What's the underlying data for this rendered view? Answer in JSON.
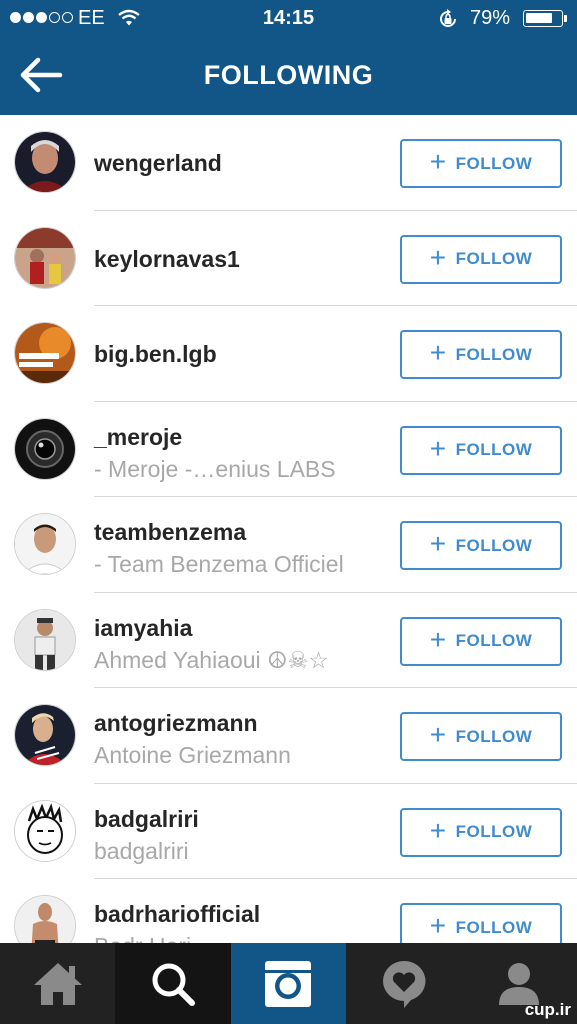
{
  "status_bar": {
    "carrier": "EE",
    "time": "14:15",
    "battery_percent": "79%",
    "battery_level": 0.79,
    "signal_bars_filled": 3,
    "signal_bars_total": 5
  },
  "nav": {
    "title": "FOLLOWING",
    "back_icon": "arrow-left-icon"
  },
  "follow_button": {
    "plus": "+",
    "label": "FOLLOW"
  },
  "users": [
    {
      "username": "wengerland",
      "full_name": ""
    },
    {
      "username": "keylornavas1",
      "full_name": ""
    },
    {
      "username": "big.ben.lgb",
      "full_name": ""
    },
    {
      "username": "_meroje",
      "full_name": "- Meroje -…enius LABS"
    },
    {
      "username": "teambenzema",
      "full_name": "- Team Benzema Officiel"
    },
    {
      "username": "iamyahia",
      "full_name": "Ahmed Yahiaoui ☮☠☆"
    },
    {
      "username": "antogriezmann",
      "full_name": "Antoine Griezmann"
    },
    {
      "username": "badgalriri",
      "full_name": "badgalriri"
    },
    {
      "username": "badrhariofficial",
      "full_name": "Badr Hari"
    }
  ],
  "tabbar": {
    "tabs": [
      "home-icon",
      "search-icon",
      "camera-icon",
      "activity-heart-icon",
      "profile-icon"
    ],
    "active_index": 2
  },
  "watermark": "cup.ir",
  "colors": {
    "header_bg": "#125688",
    "follow_blue": "#3f8bcf",
    "tabbar_bg": "#222222",
    "username_text": "#262626",
    "fullname_text": "#a8a8a8"
  }
}
